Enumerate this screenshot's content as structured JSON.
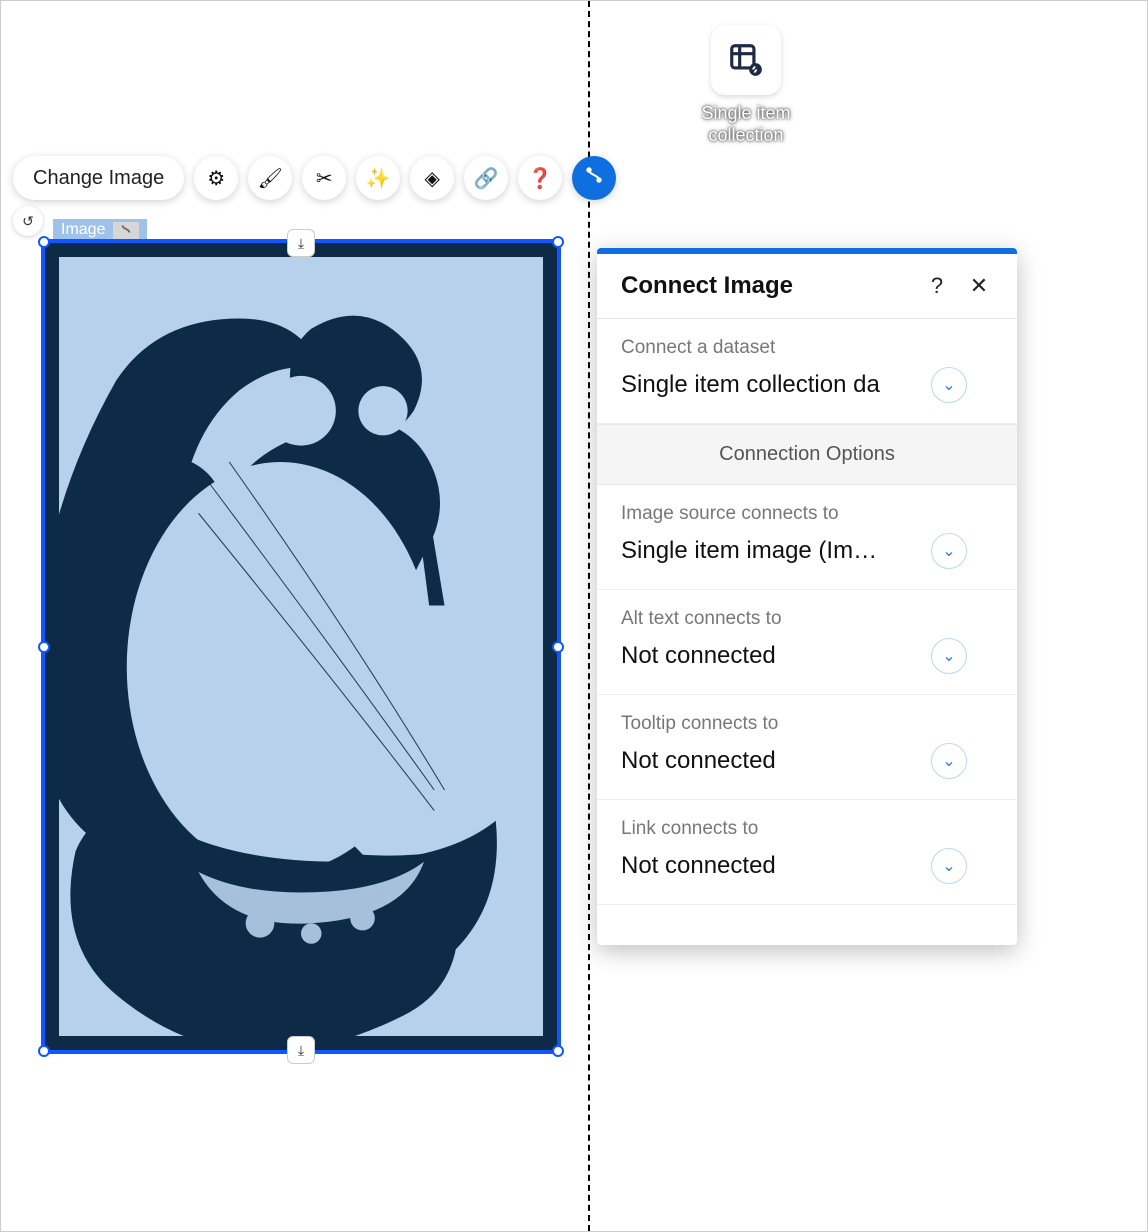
{
  "dataset_chip": {
    "label": "Single item collection"
  },
  "toolbar": {
    "change_image": "Change Image"
  },
  "element_label": "Image",
  "panel": {
    "title": "Connect Image",
    "dataset": {
      "label": "Connect a dataset",
      "value": "Single item collection da"
    },
    "section_head": "Connection Options",
    "fields": {
      "image_source": {
        "label": "Image source connects to",
        "value": "Single item image (Im…"
      },
      "alt_text": {
        "label": "Alt text connects to",
        "value": "Not connected"
      },
      "tooltip": {
        "label": "Tooltip connects to",
        "value": "Not connected"
      },
      "link": {
        "label": "Link connects to",
        "value": "Not connected"
      }
    }
  }
}
